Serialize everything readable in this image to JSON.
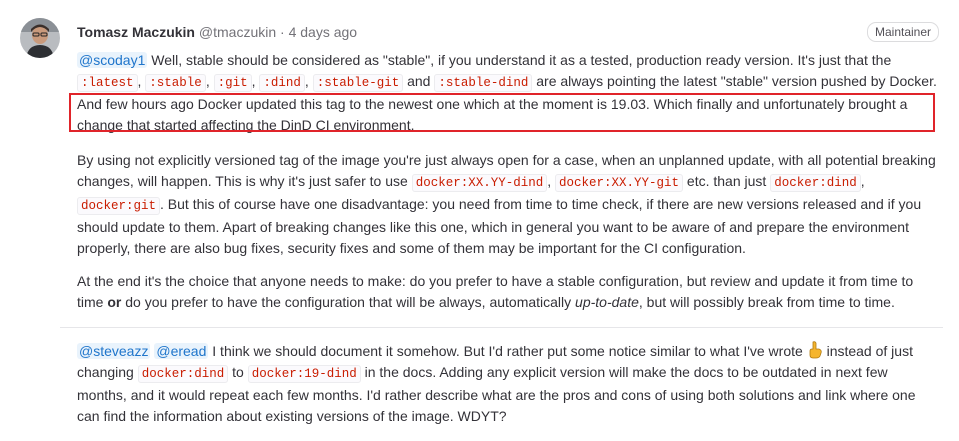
{
  "author": {
    "name": "Tomasz Maczukin",
    "handle": "@tmaczukin",
    "separator": "·",
    "time": "4 days ago",
    "role": "Maintainer"
  },
  "note1": {
    "mention": "@scoday1",
    "t1": " Well, stable should be considered as \"stable\", if you understand it as a tested, production ready version. It's just that the ",
    "c_latest": ":latest",
    "comma1": ", ",
    "c_stable": ":stable",
    "comma2": ", ",
    "c_git": ":git",
    "comma3": ", ",
    "c_dind": ":dind",
    "comma4": ", ",
    "c_stable_git": ":stable-git",
    "and1": " and ",
    "c_stable_dind": ":stable-dind",
    "t2": " are always pointing the latest \"stable\" version pushed by Docker. And few hours ago Docker updated this tag to the newest one which at the moment is 19.03. Which finally and unfortunately brought a change that started affecting the DinD CI environment."
  },
  "note2": {
    "t1": "By using not explicitly versioned tag of the image you're just always open for a case, when an unplanned update, with all potential breaking changes, will happen. This is why it's just safer to use ",
    "c1": "docker:XX.YY-dind",
    "comma1": ", ",
    "c2": "docker:XX.YY-git",
    "t2": " etc. than just ",
    "c3": "docker:dind",
    "comma2": ", ",
    "c4": "docker:git",
    "t3": ". But this of course have one disadvantage: you need from time to time check, if there are new versions released and if you should update to them. Apart of breaking changes like this one, which in general you want to be aware of and prepare the environment properly, there are also bug fixes, security fixes and some of them may be important for the CI configuration."
  },
  "note3": {
    "t1": "At the end it's the choice that anyone needs to make: do you prefer to have a stable configuration, but review and update it from time to time ",
    "bold": "or",
    "t2": " do you prefer to have the configuration that will be always, automatically ",
    "em": "up-to-date",
    "t3": ", but will possibly break from time to time."
  },
  "note4": {
    "mention1": "@steveazz",
    "space": " ",
    "mention2": "@eread",
    "t1": " I think we should document it somehow. But I'd rather put some notice similar to what I've wrote ",
    "emoji_icon": "point-up-icon",
    "t2": " instead of just changing ",
    "c1": "docker:dind",
    "to": " to ",
    "c2": "docker:19-dind",
    "t3": " in the docs. Adding any explicit version will make the docs to be outdated in next few months, and it would repeat each few months. I'd rather describe what are the pros and cons of using both solutions and link where one can find the information about existing versions of the image. WDYT?"
  },
  "colors": {
    "highlight": "#e0242a",
    "mention": "#1f75cb",
    "code": "#c91c00"
  }
}
